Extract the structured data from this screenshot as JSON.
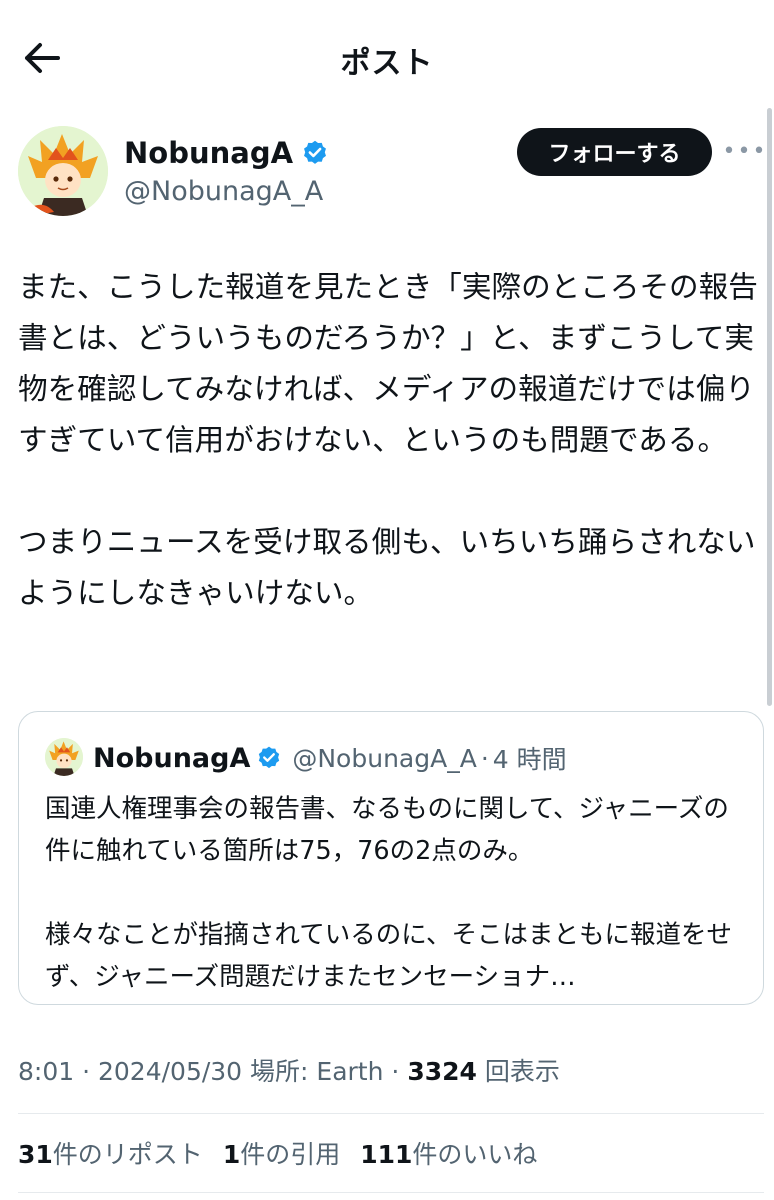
{
  "header": {
    "title": "ポスト"
  },
  "author": {
    "name": "NobunagA",
    "handle": "@NobunagA_A",
    "follow_label": "フォローする"
  },
  "post": {
    "text": "また、こうした報道を見たとき「実際のところその報告書とは、どういうものだろうか？」と、まずこうして実物を確認してみなければ、メディアの報道だけでは偏りすぎていて信用がおけない、というのも問題である。\n\nつまりニュースを受け取る側も、いちいち踊らされないようにしなきゃいけない。"
  },
  "quote": {
    "name": "NobunagA",
    "handle": "@NobunagA_A",
    "time": "4 時間",
    "text": "国連人権理事会の報告書、なるものに関して、ジャニーズの件に触れている箇所は75，76の2点のみ。\n\n様々なことが指摘されているのに、そこはまともに報道をせず、ジャニーズ問題だけまたセンセーショナ…"
  },
  "meta": {
    "time": "8:01",
    "date": "2024/05/30",
    "location": "場所: Earth",
    "views": "3324",
    "views_label": "回表示"
  },
  "stats": {
    "reposts_count": "31",
    "reposts_label": "件のリポスト",
    "quotes_count": "1",
    "quotes_label": "件の引用",
    "likes_count": "111",
    "likes_label": "件のいいね"
  },
  "colors": {
    "text": "#0f1419",
    "secondary": "#536471",
    "verified": "#1d9bf0",
    "border": "#cfd9de"
  },
  "icons": {
    "back": "arrow-left-icon",
    "verified": "verified-badge-icon",
    "more": "more-horizontal-icon"
  }
}
